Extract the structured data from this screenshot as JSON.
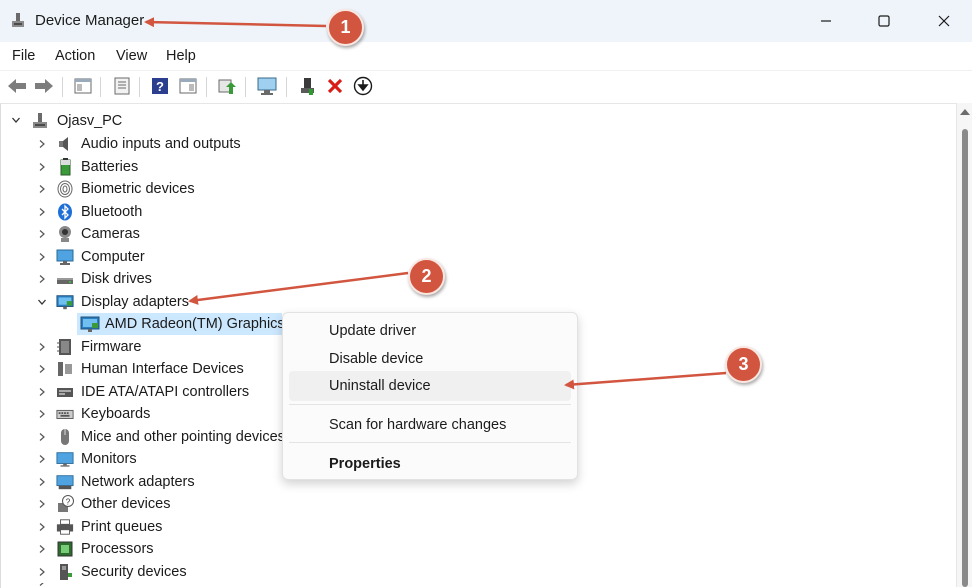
{
  "window": {
    "title": "Device Manager"
  },
  "menu": [
    "File",
    "Action",
    "View",
    "Help"
  ],
  "toolbar": [
    {
      "name": "back-icon"
    },
    {
      "name": "forward-icon"
    },
    {
      "name": "show-hide-console-tree-icon"
    },
    {
      "name": "properties-sheet-icon"
    },
    {
      "name": "help-icon"
    },
    {
      "name": "action-pane-icon"
    },
    {
      "name": "update-driver-icon"
    },
    {
      "name": "scan-hardware-icon"
    },
    {
      "name": "enable-device-icon"
    },
    {
      "name": "uninstall-device-icon"
    },
    {
      "name": "download-driver-icon"
    }
  ],
  "tree": {
    "root": "Ojasv_PC",
    "categories": [
      {
        "label": "Audio inputs and outputs",
        "icon": "speaker-icon",
        "expanded": false
      },
      {
        "label": "Batteries",
        "icon": "battery-icon",
        "expanded": false
      },
      {
        "label": "Biometric devices",
        "icon": "fingerprint-icon",
        "expanded": false
      },
      {
        "label": "Bluetooth",
        "icon": "bluetooth-icon",
        "expanded": false
      },
      {
        "label": "Cameras",
        "icon": "camera-icon",
        "expanded": false
      },
      {
        "label": "Computer",
        "icon": "computer-icon",
        "expanded": false
      },
      {
        "label": "Disk drives",
        "icon": "disk-drive-icon",
        "expanded": false
      },
      {
        "label": "Display adapters",
        "icon": "display-adapter-icon",
        "expanded": true
      },
      {
        "label": "AMD Radeon(TM) Graphics",
        "icon": "display-adapter-icon",
        "child": true
      },
      {
        "label": "Firmware",
        "icon": "firmware-icon",
        "expanded": false
      },
      {
        "label": "Human Interface Devices",
        "icon": "hid-icon",
        "expanded": false
      },
      {
        "label": "IDE ATA/ATAPI controllers",
        "icon": "ide-controller-icon",
        "expanded": false
      },
      {
        "label": "Keyboards",
        "icon": "keyboard-icon",
        "expanded": false
      },
      {
        "label": "Mice and other pointing devices",
        "icon": "mouse-icon",
        "expanded": false
      },
      {
        "label": "Monitors",
        "icon": "monitor-icon",
        "expanded": false
      },
      {
        "label": "Network adapters",
        "icon": "network-adapter-icon",
        "expanded": false
      },
      {
        "label": "Other devices",
        "icon": "other-devices-icon",
        "expanded": false
      },
      {
        "label": "Print queues",
        "icon": "printer-icon",
        "expanded": false
      },
      {
        "label": "Processors",
        "icon": "processor-icon",
        "expanded": false
      },
      {
        "label": "Security devices",
        "icon": "security-device-icon",
        "expanded": false
      }
    ]
  },
  "context_menu": {
    "items": [
      "Update driver",
      "Disable device",
      "Uninstall device",
      "Scan for hardware changes",
      "Properties"
    ],
    "highlighted": "Uninstall device"
  },
  "annotations": {
    "badges": [
      "1",
      "2",
      "3"
    ],
    "color": "#d2553f"
  },
  "colors": {
    "selection": "#cce8ff",
    "titlebar": "#eef4f9",
    "accent": "#0078d4",
    "annotation": "#d2553f"
  }
}
